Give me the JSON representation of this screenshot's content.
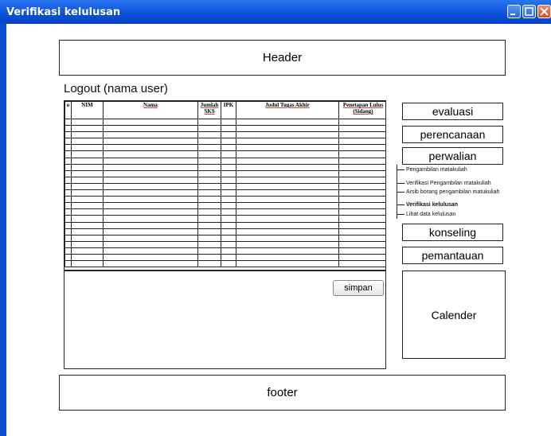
{
  "window": {
    "title": "Verifikasi kelulusan"
  },
  "header": {
    "label": "Header"
  },
  "footer": {
    "label": "footer"
  },
  "logout": {
    "label": "Logout (nama user)"
  },
  "table": {
    "columns": [
      "o",
      "NIM",
      "Nama",
      "Jumlah SKS",
      "IPK",
      "Judul Tugas Akhir",
      "Penetapan Lulus (Sidang)"
    ]
  },
  "form": {
    "save_label": "simpan"
  },
  "menu": {
    "evaluasi": "evaluasi",
    "perencanaan": "perencanaan",
    "perwalian": "perwalian",
    "konseling": "konseling",
    "pemantauan": "pemantauan"
  },
  "submenu": [
    {
      "label": "Pengambilan matakuliah"
    },
    {
      "label": "Verifikasi Pengambilan matakuliah"
    },
    {
      "label": "Arsib borang pengambilan matukuliah"
    },
    {
      "label": "Verifikasi kelulusan"
    },
    {
      "label": "Lihat data kelulusan"
    }
  ],
  "calendar": {
    "label": "Calender"
  }
}
